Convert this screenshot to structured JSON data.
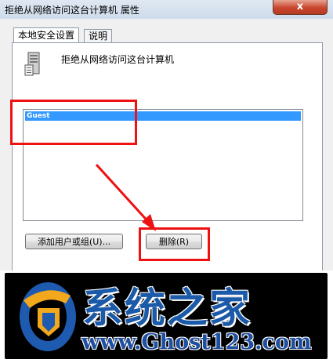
{
  "window": {
    "title": "拒绝从网络访问这台计算机 属性",
    "close_label": "x"
  },
  "tabs": [
    {
      "label": "本地安全设置"
    },
    {
      "label": "说明"
    }
  ],
  "policy": {
    "name": "拒绝从网络访问这台计算机",
    "icon": "server-policy-icon"
  },
  "list": {
    "items": [
      "Guest"
    ],
    "selected": "Guest"
  },
  "buttons": {
    "add_label": "添加用户或组(U)...",
    "remove_label": "删除(R)"
  },
  "watermark": {
    "brand_cn": "系统之家",
    "url": "www.Ghost123.com"
  },
  "colors": {
    "highlight": "#3399ff",
    "annotation": "#ee1111",
    "brand": "#1b5aa8"
  }
}
